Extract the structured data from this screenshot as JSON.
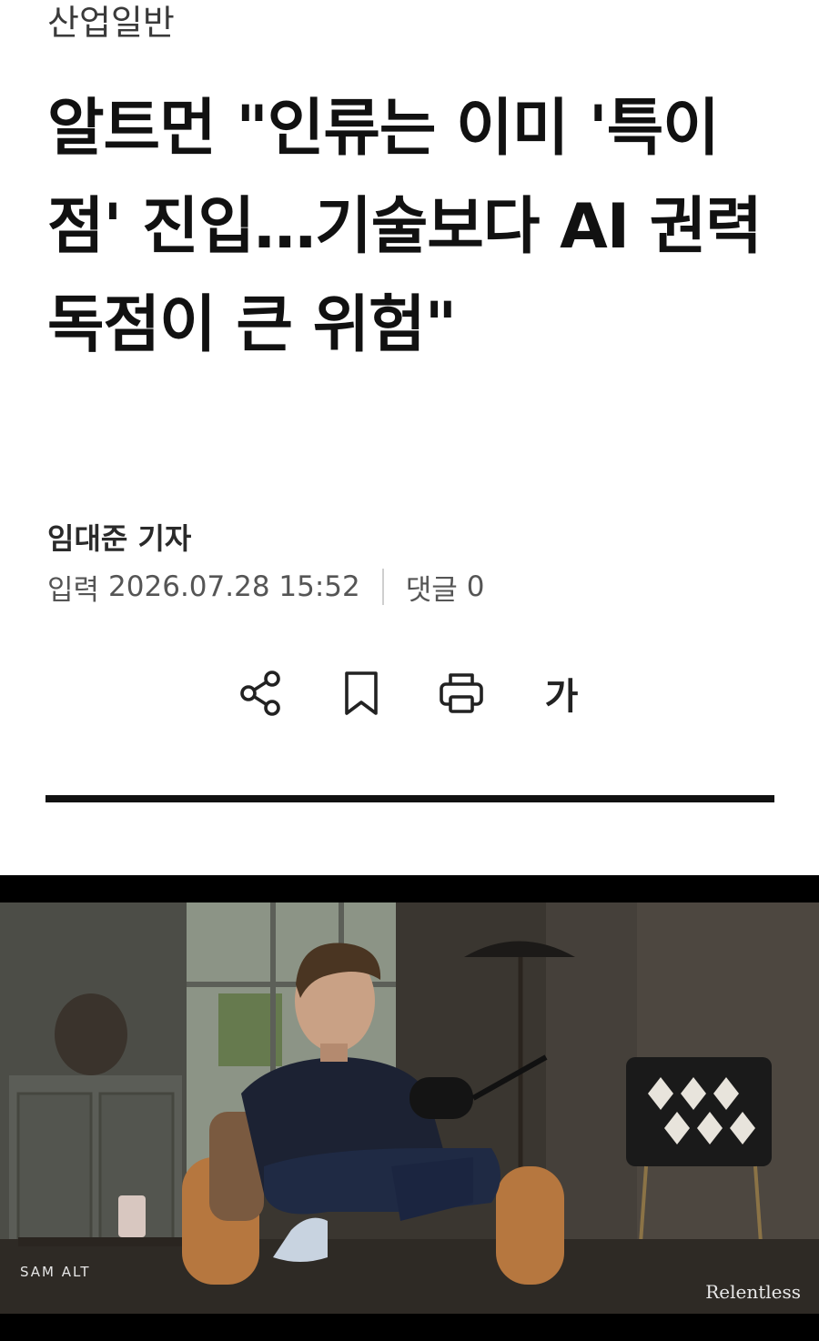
{
  "article": {
    "section": "산업일반",
    "headline": "알트먼 \"인류는 이미 '특이점' 진입…기술보다 AI 권력 독점이 큰 위험\"",
    "author": "임대준 기자",
    "published_label": "입력",
    "published_at": "2026.07.28 15:52",
    "comments_label": "댓글",
    "comments_count": "0"
  },
  "toolbar": {
    "share_icon": "share-icon",
    "bookmark_icon": "bookmark-icon",
    "print_icon": "print-icon",
    "font_size_label": "가"
  },
  "video": {
    "caption_left": "SAM ALT",
    "caption_right": "Relentless"
  },
  "colors": {
    "text": "#111111",
    "muted": "#555555",
    "divider": "#cfcfcf",
    "rule": "#111111"
  }
}
